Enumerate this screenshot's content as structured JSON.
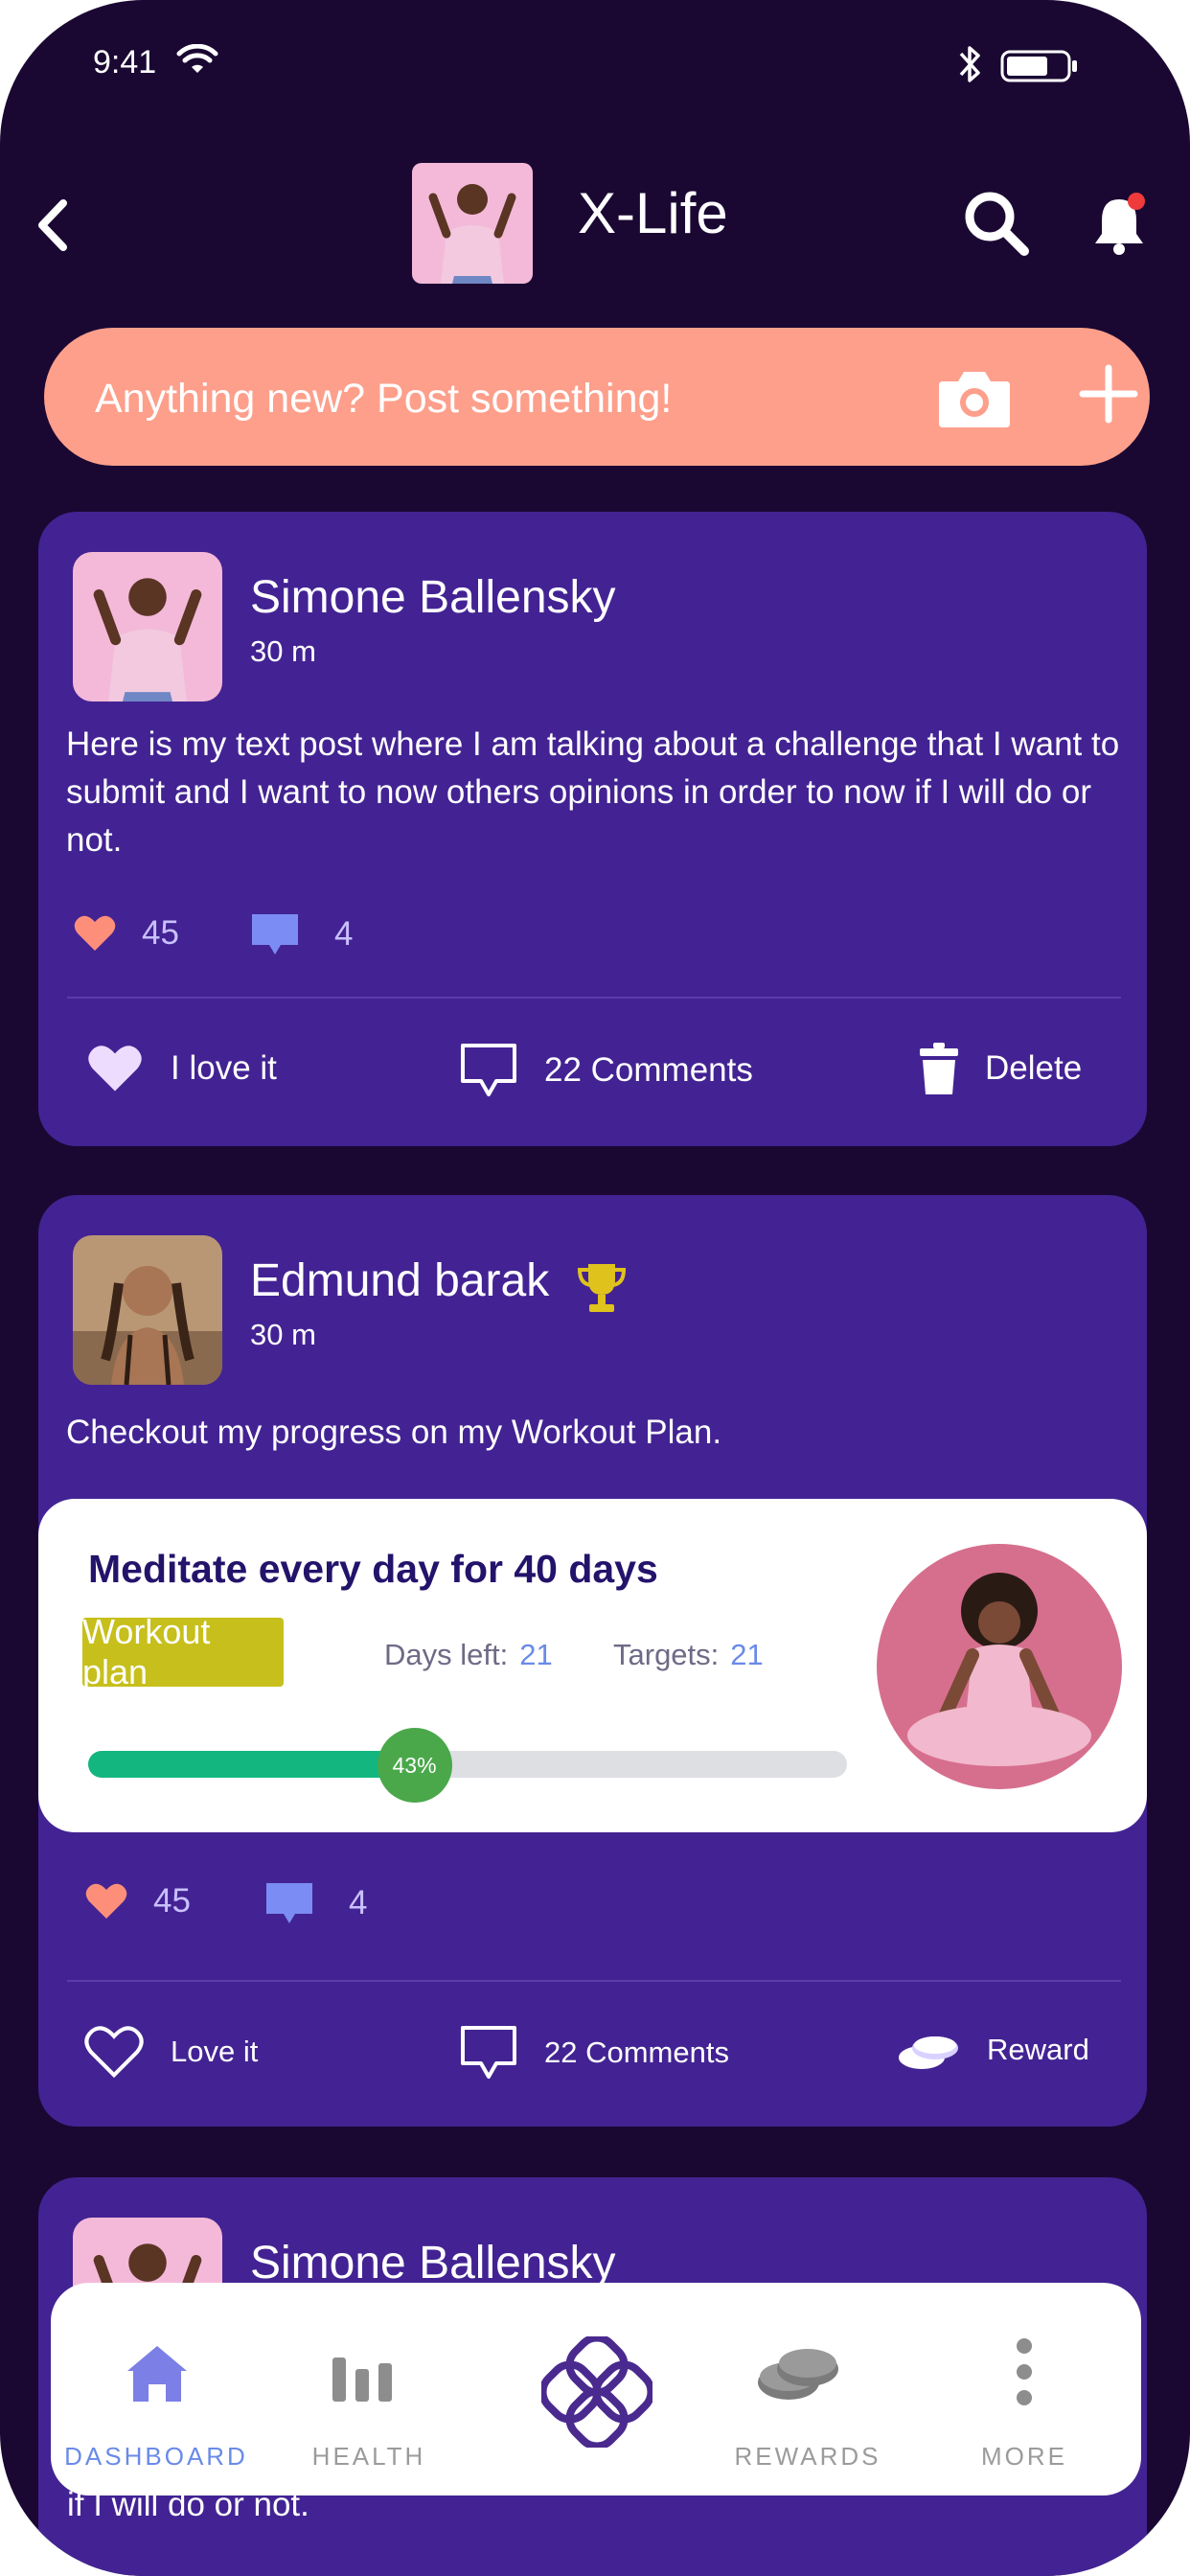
{
  "status_bar": {
    "time": "9:41"
  },
  "header": {
    "title": "X-Life"
  },
  "composer": {
    "placeholder": "Anything new? Post something!"
  },
  "posts": [
    {
      "author": "Simone Ballensky",
      "time": "30 m",
      "text": "Here is my text post where I am talking about a challenge that I want to submit and I want to now others opinions in order to now if I will do or not.",
      "likes": "45",
      "comments_count": "4",
      "actions": {
        "love": "I love it",
        "comments": "22 Comments",
        "third": "Delete"
      }
    },
    {
      "author": "Edmund barak",
      "time": "30 m",
      "text": "Checkout my progress on my Workout Plan.",
      "plan": {
        "title": "Meditate every day for 40 days",
        "tag": "Workout plan",
        "days_left_label": "Days left:",
        "days_left": "21",
        "targets_label": "Targets:",
        "targets": "21",
        "progress_label": "43%",
        "progress": 0.43
      },
      "likes": "45",
      "comments_count": "4",
      "actions": {
        "love": "Love it",
        "comments": "22 Comments",
        "third": "Reward"
      }
    },
    {
      "author": "Simone Ballensky",
      "trailing_text": "if I will do or not."
    }
  ],
  "nav": {
    "items": [
      {
        "label": "DASHBOARD",
        "active": true
      },
      {
        "label": "HEALTH"
      },
      {
        "label": ""
      },
      {
        "label": "REWARDS"
      },
      {
        "label": "MORE"
      }
    ]
  },
  "colors": {
    "background": "#1a0833",
    "card": "#432393",
    "composer": "#fd9f8b",
    "accent_blue": "#6a8ae8",
    "like": "#fd8f7a",
    "progress": "#13b67e",
    "tag": "#c7bf1b"
  }
}
